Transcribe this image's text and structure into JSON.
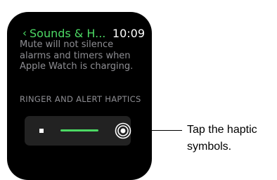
{
  "status_bar": {
    "back_chevron": "‹",
    "back_label": "Sounds & H...",
    "time": "10:09"
  },
  "info_text": "Mute will not silence alarms and timers when Apple Watch is charging.",
  "section_header": "RINGER AND ALERT HAPTICS",
  "haptics": {
    "min_icon": "square-icon",
    "max_icon": "concentric-circles-icon",
    "level": 0.6
  },
  "callout": {
    "line1": "Tap the haptic",
    "line2": "symbols."
  },
  "colors": {
    "accent": "#4cd964",
    "screen_bg": "#000000",
    "row_bg": "#222222",
    "secondary_text": "#8e8e93"
  }
}
